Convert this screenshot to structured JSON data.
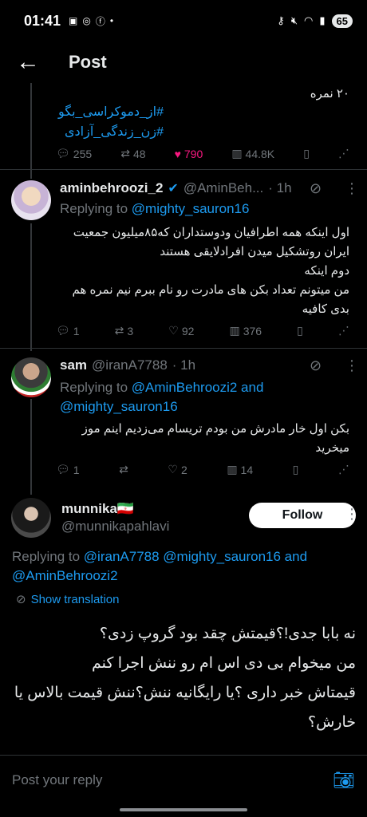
{
  "status_bar": {
    "time": "01:41",
    "battery": "65"
  },
  "header": {
    "title": "Post"
  },
  "prev_post": {
    "score_line": "۲۰ نمره",
    "hashtags": [
      "#از_دموکراسی_بگو",
      "#زن_زندگی_آزادی"
    ],
    "stats": {
      "replies": "255",
      "reposts": "48",
      "likes": "790",
      "views": "44.8K"
    }
  },
  "reply1": {
    "name": "aminbehroozi_2",
    "handle": "@AminBeh...",
    "time": "· 1h",
    "replying_prefix": "Replying to",
    "replying_to": "@mighty_sauron16",
    "body": [
      "اول اینکه همه اطرافیان ودوستداران که۸۵میلیون جمعیت",
      "ایران روتشکیل میدن افرادلایقی هستند",
      "دوم اینکه",
      "من میتونم تعداد بکن های مادرت رو نام ببرم نیم نمره هم",
      "بدی کافیه"
    ],
    "stats": {
      "replies": "1",
      "reposts": "3",
      "likes": "92",
      "views": "376"
    }
  },
  "reply2": {
    "name": "sam",
    "handle": "@iranA7788",
    "time": "· 1h",
    "replying_prefix": "Replying to",
    "replying_to": "@AminBehroozi2 and",
    "replying_to_2": "@mighty_sauron16",
    "body": [
      "بکن اول خار مادرش من بودم تریسام می‌زدیم اینم موز",
      "میخرید"
    ],
    "stats": {
      "replies": "1",
      "reposts": "",
      "likes": "2",
      "views": "14"
    }
  },
  "main_post": {
    "name": "munnika🇮🇷",
    "handle": "@munnikapahlavi",
    "follow_label": "Follow",
    "replying_prefix": "Replying to",
    "replying_to": "@iranA7788 @mighty_sauron16 and",
    "replying_to_2": "@AminBehroozi2",
    "translate_label": "Show translation",
    "body": [
      "نه بابا جدی!؟قیمتش چقد بود گروپ زدی؟",
      "من میخوام بی دی اس ام رو ننش اجرا کنم",
      "قیمتاش خبر داری ؟یا رایگانیه ننش؟ننش قیمت بالاس یا",
      "خارش؟"
    ]
  },
  "composer": {
    "placeholder": "Post your reply"
  },
  "colors": {
    "accent": "#1d9bf0",
    "like": "#f91880",
    "background": "#000000"
  }
}
